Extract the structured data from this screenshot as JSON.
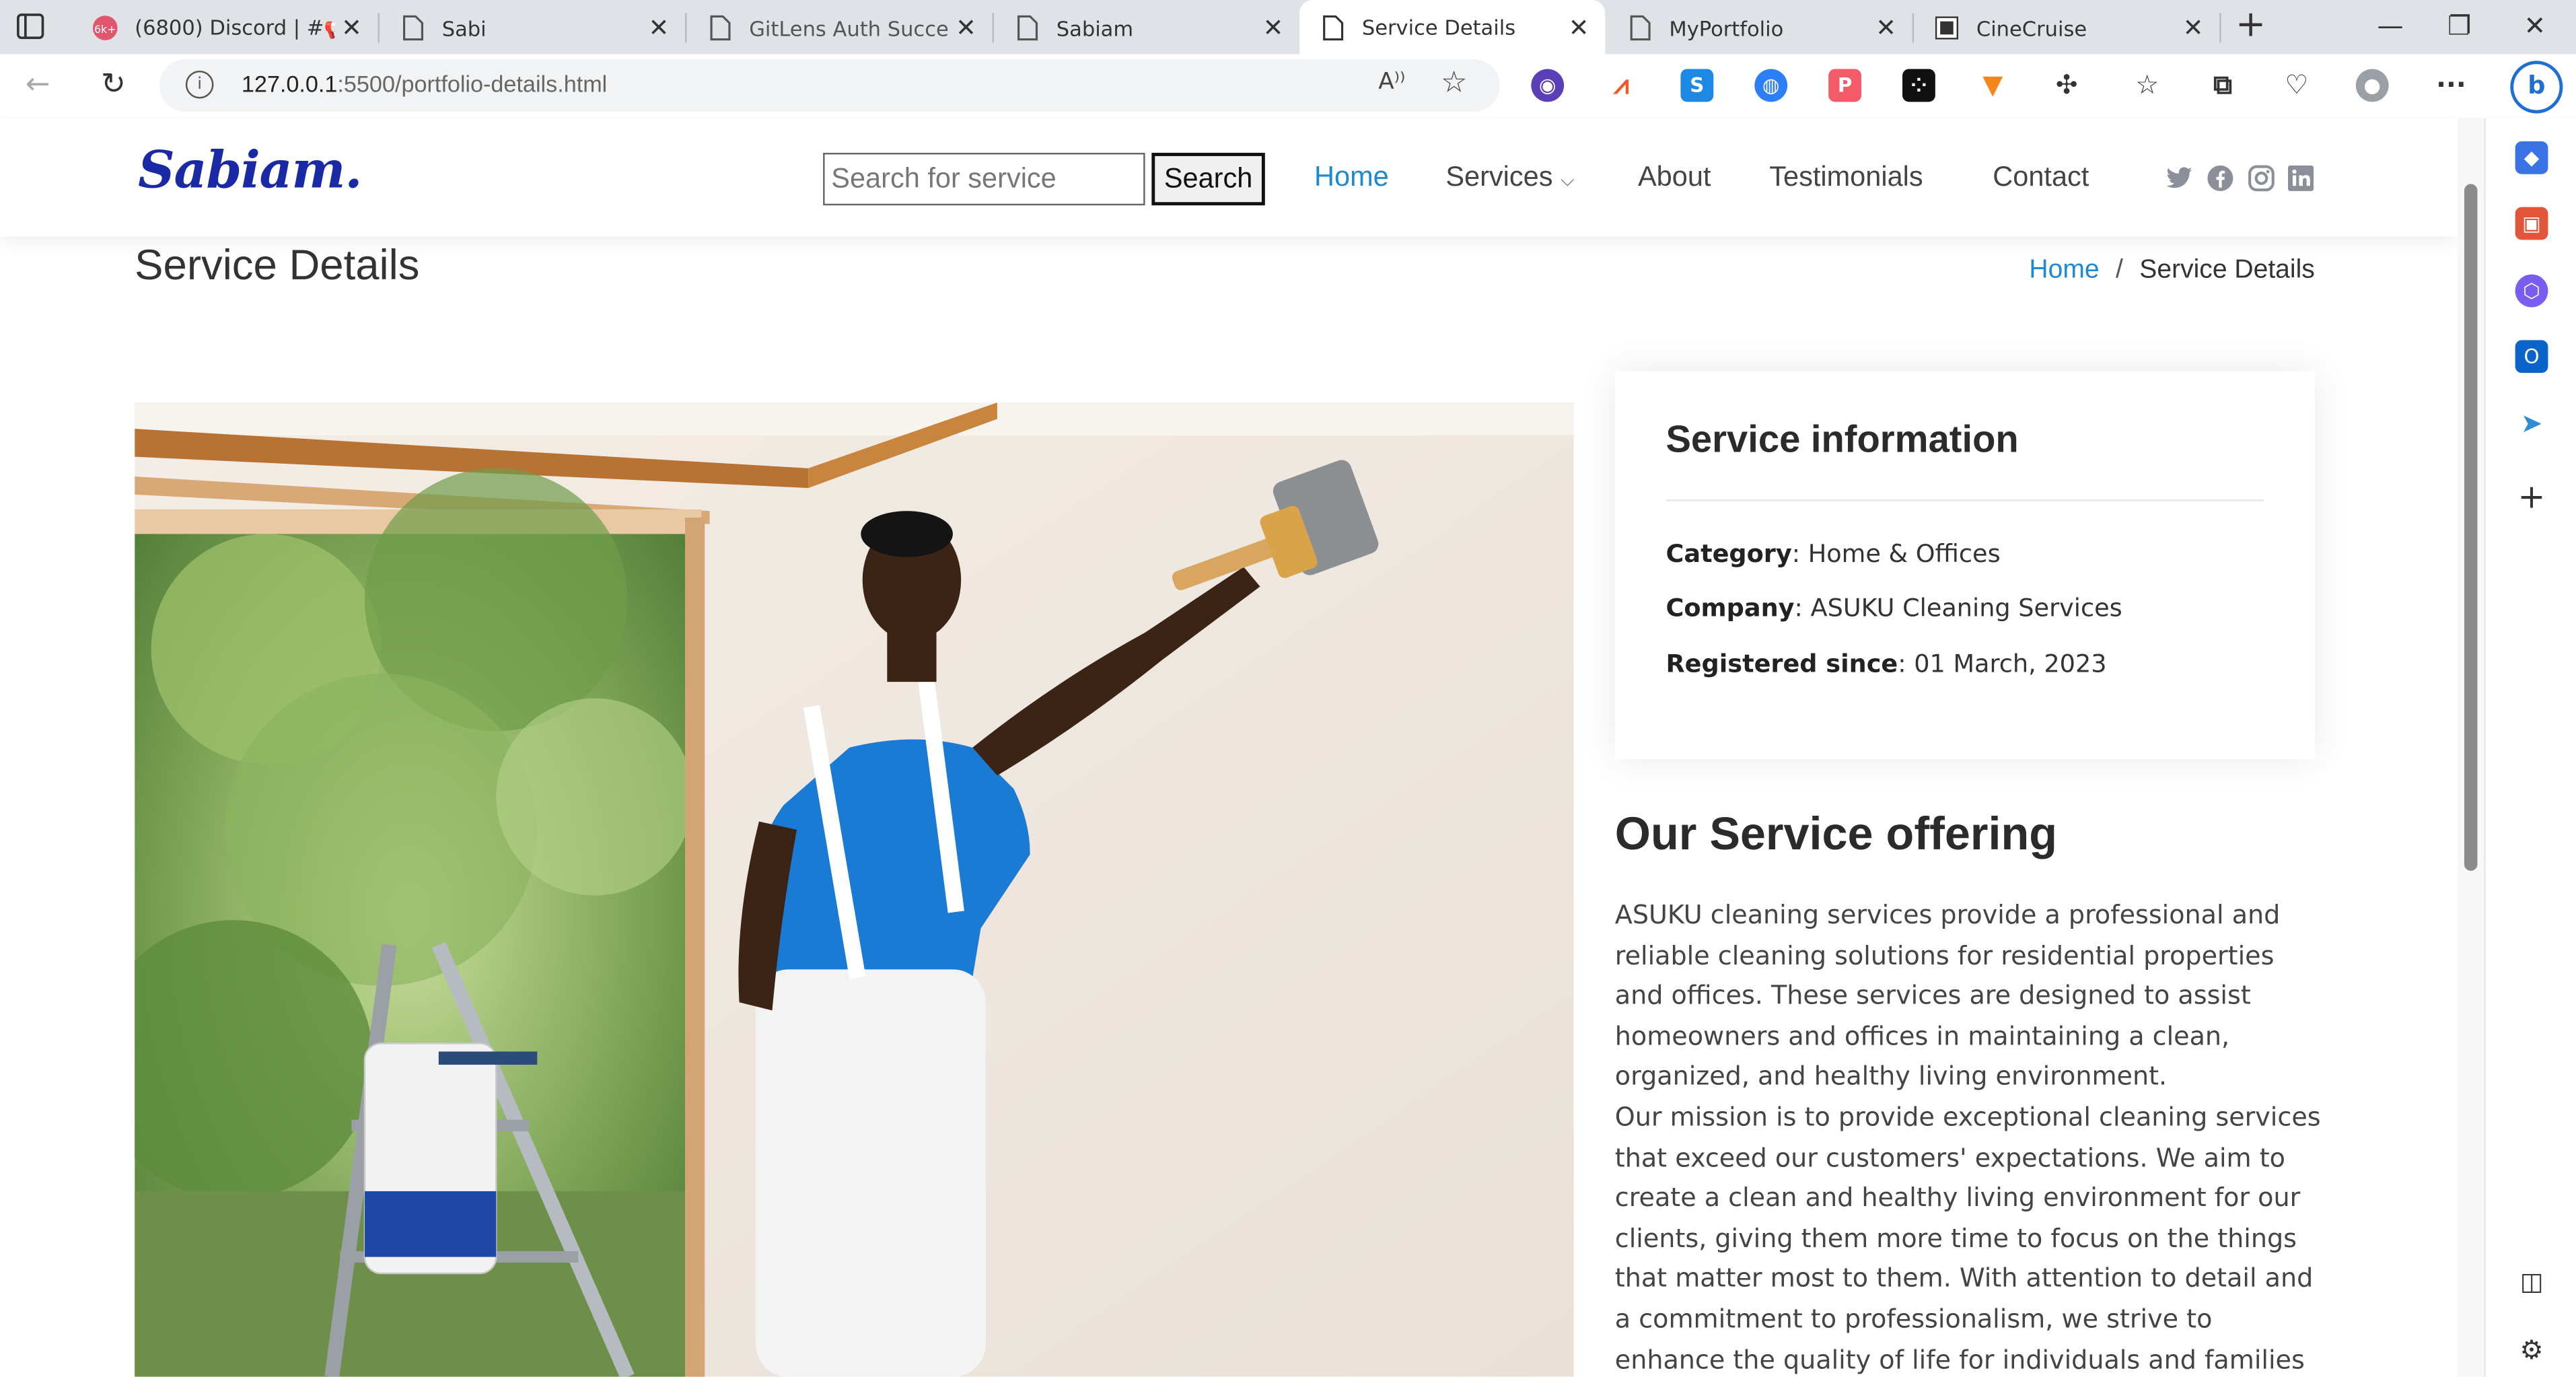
{
  "browser": {
    "tabs": [
      {
        "title": "(6800) Discord | #📢 ",
        "badge": "6k+"
      },
      {
        "title": "Sabi"
      },
      {
        "title": "GitLens Auth Success"
      },
      {
        "title": "Sabiam"
      },
      {
        "title": "Service Details"
      },
      {
        "title": "MyPortfolio"
      },
      {
        "title": "CineCruise"
      }
    ],
    "active_tab": 4,
    "url_host": "127.0.0.1",
    "url_rest": ":5500/portfolio-details.html"
  },
  "site": {
    "logo": "Sabiam.",
    "search": {
      "placeholder": "Search for service",
      "button": "Search"
    },
    "nav": [
      "Home",
      "Services",
      "About",
      "Testimonials",
      "Contact"
    ],
    "nav_active": "Home",
    "social": [
      "twitter-icon",
      "facebook-icon",
      "instagram-icon",
      "linkedin-icon"
    ],
    "accent": "#1e88d2",
    "logo_color": "#1a2aa6"
  },
  "page": {
    "title": "Service Details",
    "breadcrumb": {
      "home": "Home",
      "separator": "/",
      "current": "Service Details"
    }
  },
  "info": {
    "heading": "Service information",
    "rows": [
      {
        "label": "Category",
        "value": ": Home & Offices"
      },
      {
        "label": "Company",
        "value": ": ASUKU Cleaning Services"
      },
      {
        "label": "Registered since",
        "value": ": 01 March, 2023"
      }
    ]
  },
  "offering": {
    "heading": "Our Service offering",
    "para1": "ASUKU cleaning services provide a professional and reliable cleaning solutions for residential properties and offices. These services are designed to assist homeowners and offices in maintaining a clean, organized, and healthy living environment.",
    "para2": "Our mission is to provide exceptional cleaning services that exceed our customers' expectations. We aim to create a clean and healthy living environment for our clients, giving them more time to focus on the things that matter most to them. With attention to detail and a commitment to professionalism, we strive to enhance the quality of life for individuals and families by"
  }
}
